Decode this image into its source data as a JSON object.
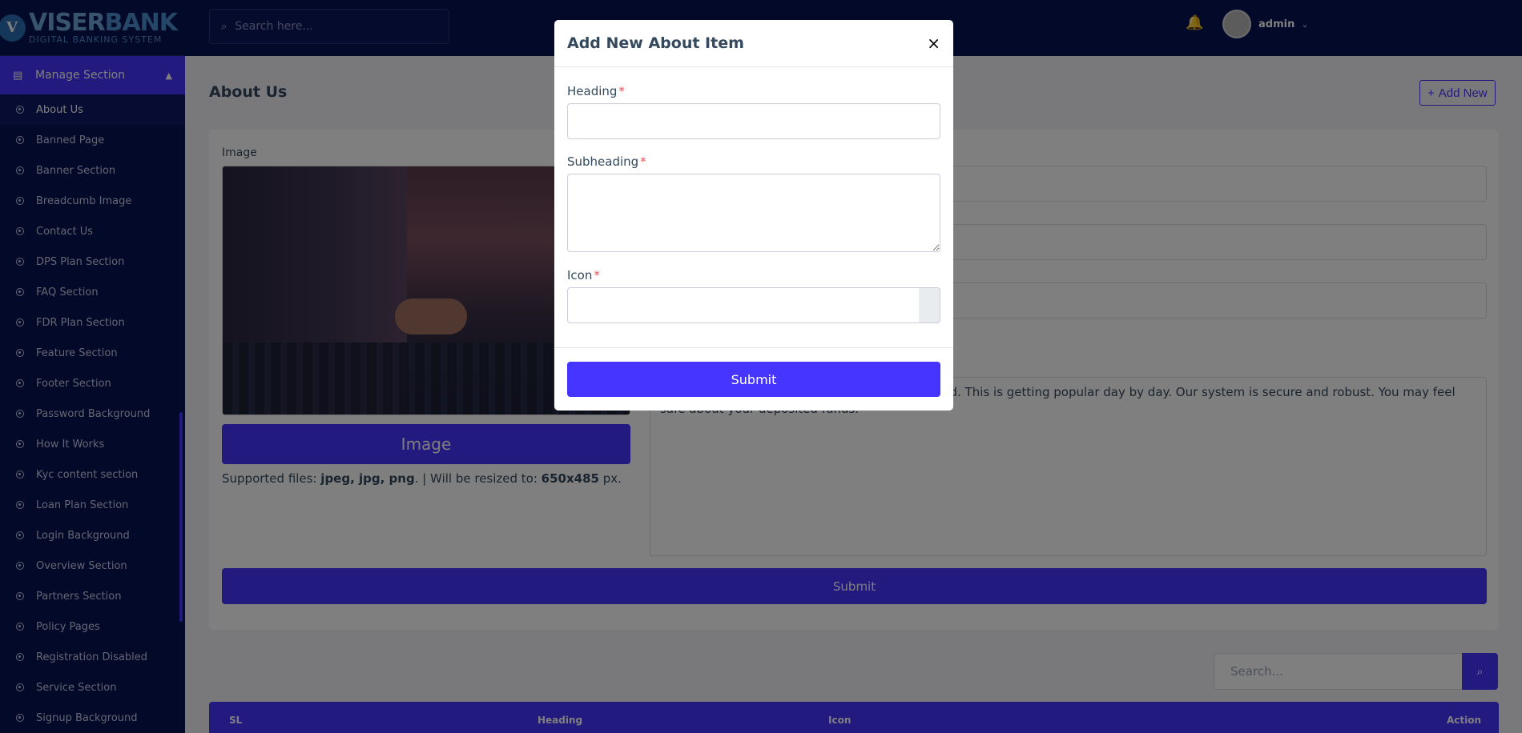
{
  "brand": {
    "name_a": "VISER",
    "name_b": "BANK",
    "tagline": "DIGITAL BANKING SYSTEM"
  },
  "sidebar": {
    "section_title": "Manage Section",
    "items": [
      {
        "label": "About Us",
        "active": true
      },
      {
        "label": "Banned Page"
      },
      {
        "label": "Banner Section"
      },
      {
        "label": "Breadcumb Image"
      },
      {
        "label": "Contact Us"
      },
      {
        "label": "DPS Plan Section"
      },
      {
        "label": "FAQ Section"
      },
      {
        "label": "FDR Plan Section"
      },
      {
        "label": "Feature Section"
      },
      {
        "label": "Footer Section"
      },
      {
        "label": "Password Background"
      },
      {
        "label": "How It Works"
      },
      {
        "label": "Kyc content section"
      },
      {
        "label": "Loan Plan Section"
      },
      {
        "label": "Login Background"
      },
      {
        "label": "Overview Section"
      },
      {
        "label": "Partners Section"
      },
      {
        "label": "Policy Pages"
      },
      {
        "label": "Registration Disabled"
      },
      {
        "label": "Service Section"
      },
      {
        "label": "Signup Background"
      }
    ]
  },
  "topbar": {
    "search_placeholder": "Search here...",
    "username": "admin"
  },
  "page": {
    "title": "About Us",
    "add_new_label": "Add New",
    "image_label": "Image",
    "image_button_label": "Image",
    "supported_prefix": "Supported files: ",
    "supported_types": "jpeg, jpg, png",
    "supported_mid": ". | Will be resized to: ",
    "supported_size": "650x485",
    "supported_suffix": " px.",
    "description_text": "... account-holders from almost all over the world. This is getting popular day by day. Our system is secure and robust. You may feel safe about your deposited funds.",
    "submit_label": "Submit"
  },
  "table": {
    "search_placeholder": "Search...",
    "columns": [
      "SL",
      "Heading",
      "Icon",
      "Action"
    ]
  },
  "modal": {
    "title": "Add New About Item",
    "close_glyph": "×",
    "heading_label": "Heading",
    "subheading_label": "Subheading",
    "icon_label": "Icon",
    "required_mark": "*",
    "submit_label": "Submit"
  },
  "colors": {
    "primary": "#4634ff",
    "sidebar_bg": "#071251",
    "required": "#ea5455"
  }
}
